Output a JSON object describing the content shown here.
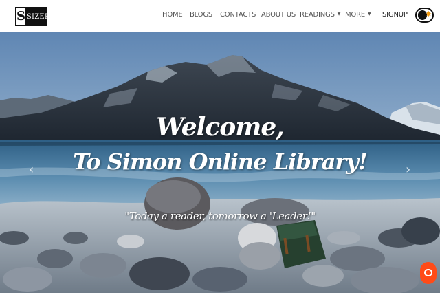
{
  "brand": {
    "mark": "S",
    "name": "SIZER"
  },
  "nav": {
    "items": [
      {
        "label": "HOME"
      },
      {
        "label": "BLOGS"
      },
      {
        "label": "CONTACTS"
      },
      {
        "label": "ABOUT US"
      },
      {
        "label": "READINGS",
        "dropdown": true
      },
      {
        "label": "MORE",
        "dropdown": true
      }
    ],
    "signup": "SIGNUP",
    "theme_toggle_icon": "sun-icon"
  },
  "hero": {
    "line1": "Welcome,",
    "line2": "To Simon Online Library!",
    "quote": "\"Today a reader, tomorrow a 'Leader!\"",
    "prev_icon": "chevron-left-icon",
    "next_icon": "chevron-right-icon"
  },
  "chat": {
    "icon": "chat-bubble-icon"
  },
  "colors": {
    "accent": "#ff4b18",
    "sun": "#f29a10",
    "nav_text": "#555555"
  }
}
